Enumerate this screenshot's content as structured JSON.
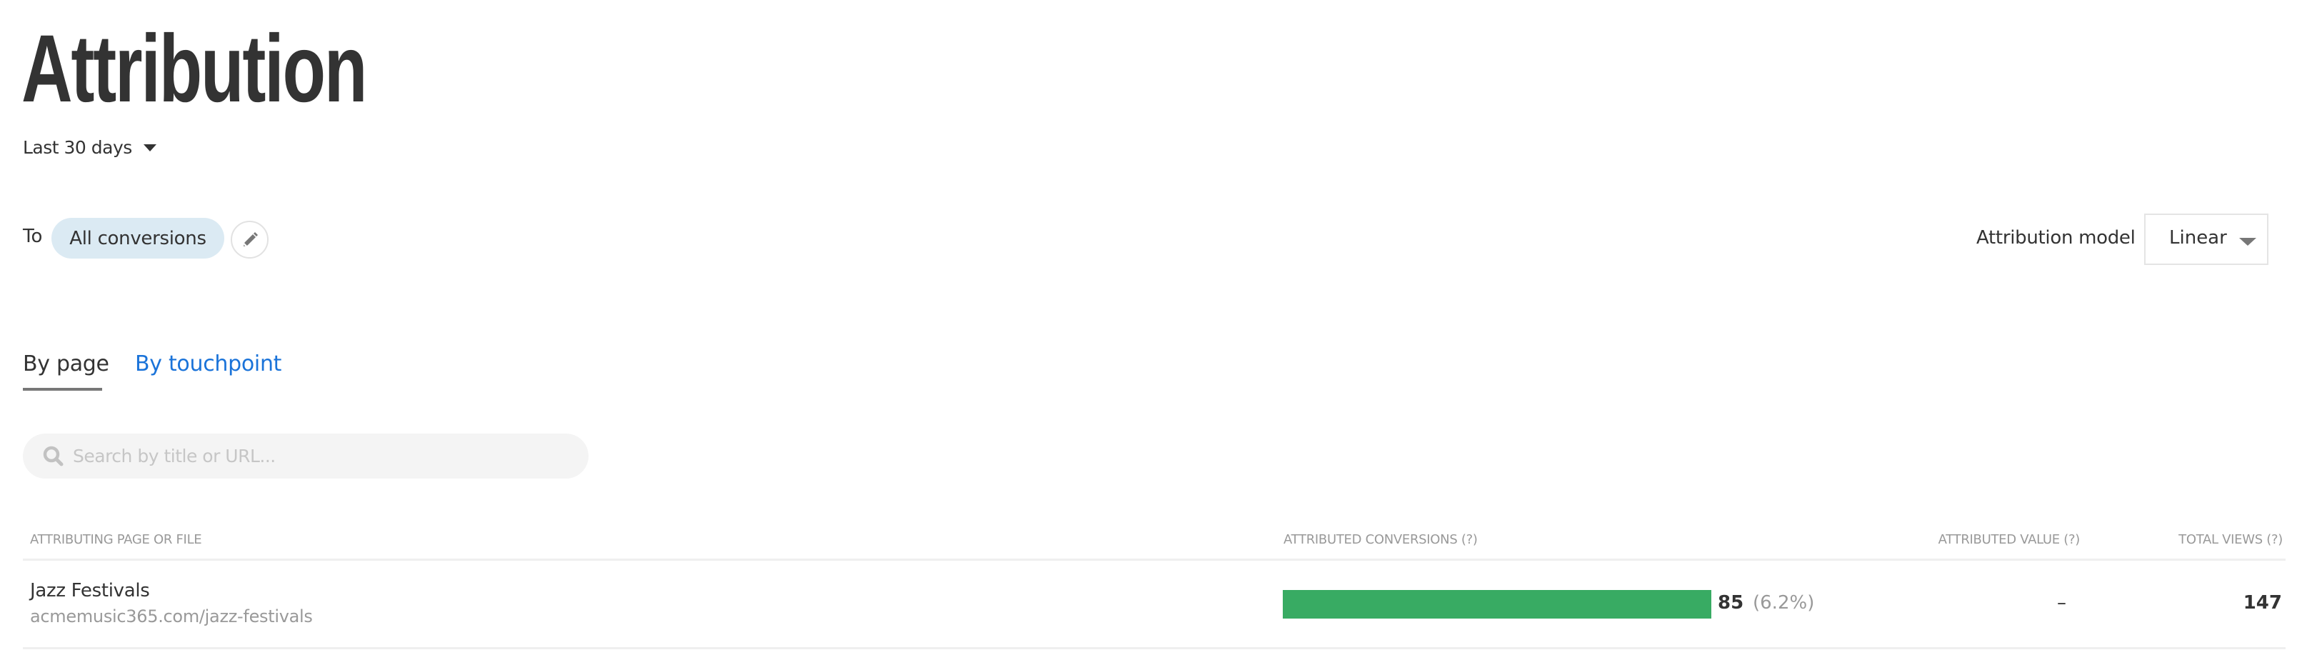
{
  "header": {
    "title": "Attribution",
    "date_range": "Last 30 days"
  },
  "conversion_filter": {
    "prefix": "To",
    "selected": "All conversions",
    "edit_icon": "pencil-icon"
  },
  "attribution_model": {
    "label": "Attribution model",
    "selected": "Linear"
  },
  "tabs": [
    {
      "label": "By page",
      "active": true
    },
    {
      "label": "By touchpoint",
      "active": false
    }
  ],
  "search": {
    "placeholder": "Search by title or URL...",
    "value": ""
  },
  "table": {
    "columns": [
      "ATTRIBUTING PAGE OR FILE",
      "ATTRIBUTED CONVERSIONS (?)",
      "ATTRIBUTED VALUE (?)",
      "TOTAL VIEWS (?)"
    ],
    "rows": [
      {
        "title": "Jazz Festivals",
        "url": "acmemusic365.com/jazz-festivals",
        "conversions": "85",
        "conversions_pct": "(6.2%)",
        "conversions_bar_fraction": 1.0,
        "value": "–",
        "views": "147"
      }
    ]
  },
  "colors": {
    "accent_link": "#1a73d9",
    "bar": "#38ab63",
    "pill_bg": "#dbeaf3"
  }
}
